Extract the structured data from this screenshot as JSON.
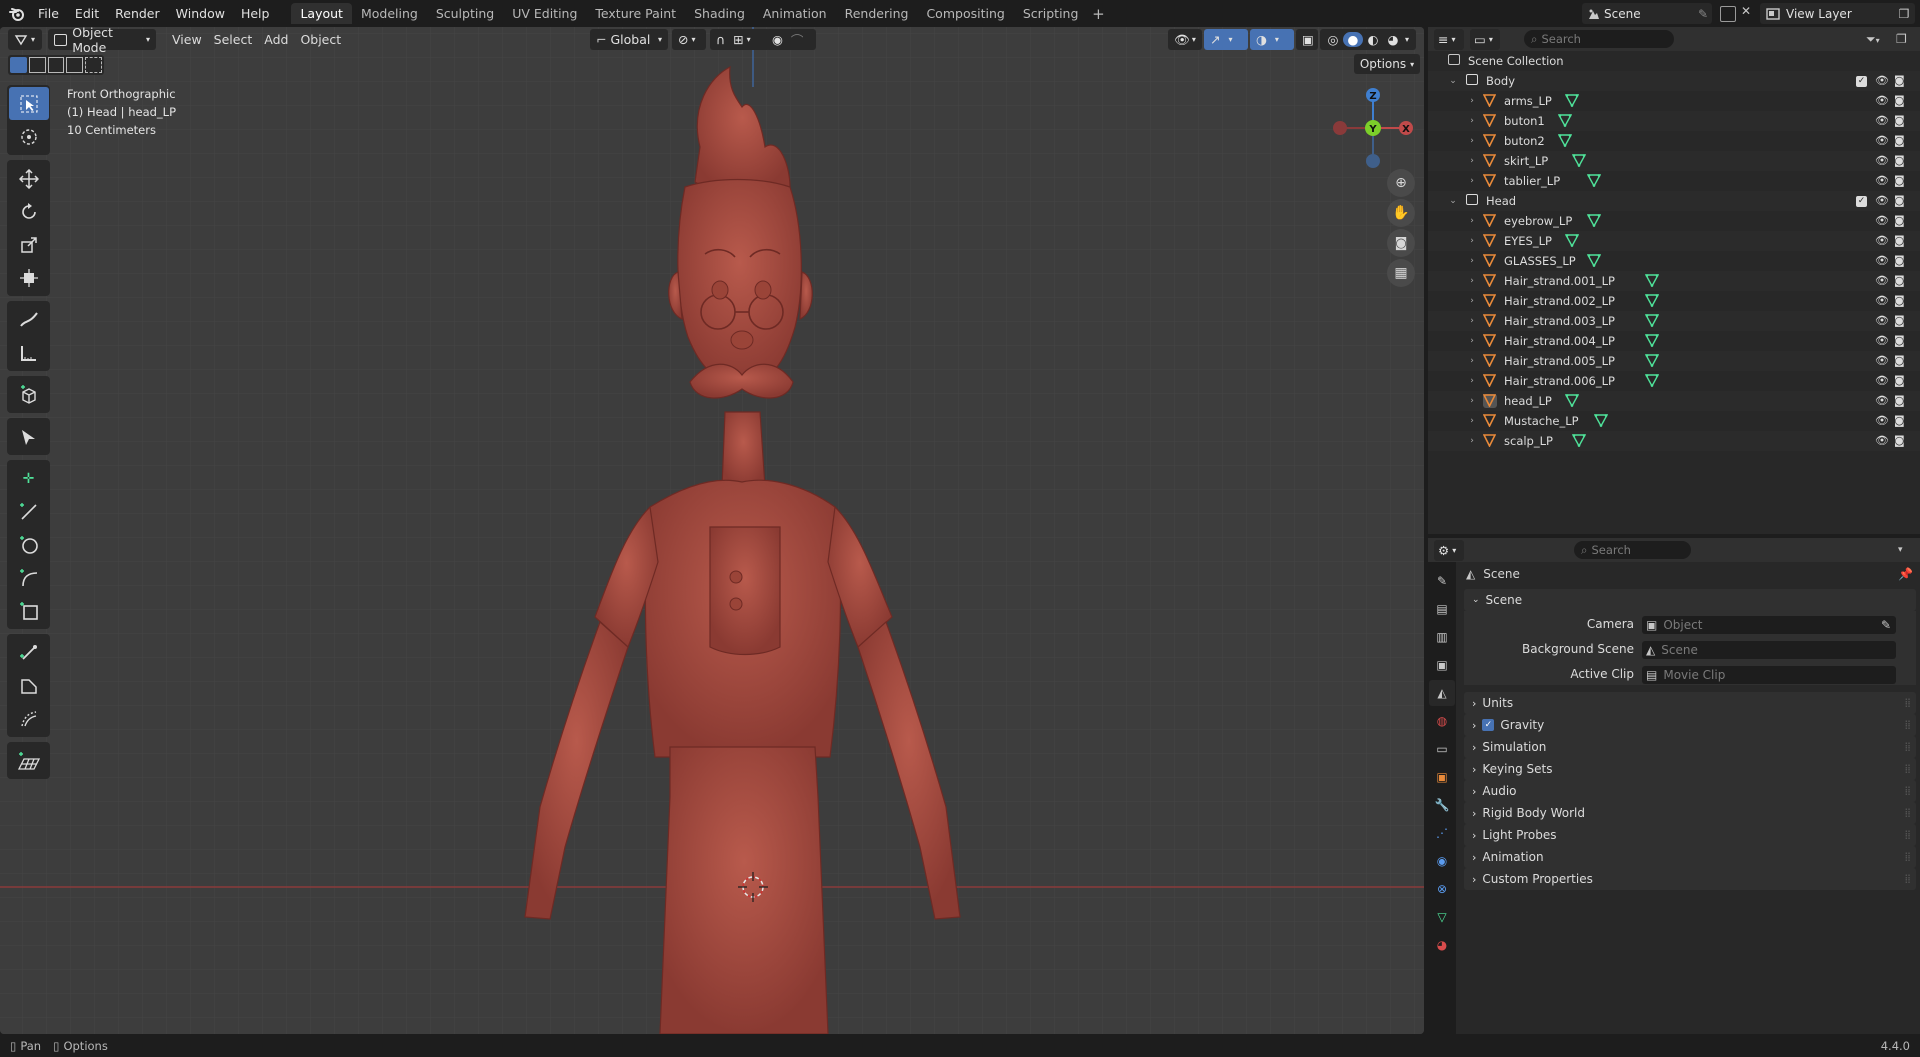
{
  "menu": {
    "items": [
      "File",
      "Edit",
      "Render",
      "Window",
      "Help"
    ]
  },
  "workspaces": {
    "tabs": [
      "Layout",
      "Modeling",
      "Sculpting",
      "UV Editing",
      "Texture Paint",
      "Shading",
      "Animation",
      "Rendering",
      "Compositing",
      "Scripting"
    ],
    "active": "Layout",
    "add": "+"
  },
  "scene_selector": "Scene",
  "view_layer": "View Layer",
  "viewport": {
    "mode": "Object Mode",
    "menus": [
      "View",
      "Select",
      "Add",
      "Object"
    ],
    "transform_orientation": "Global",
    "options_label": "Options",
    "info_line1": "Front Orthographic",
    "info_line2": "(1) Head | head_LP",
    "info_line3": "10 Centimeters",
    "gizmo_labels": {
      "z": "Z",
      "y": "Y",
      "x": "X"
    },
    "colors": {
      "background": "#3d3d3d",
      "model": "#a0473c",
      "x_axis": "#c04a4a",
      "y_axis": "#7ccf2a",
      "z_axis": "#3f7fd0",
      "accent": "#4772b3"
    }
  },
  "outliner": {
    "search_placeholder": "Search",
    "root": "Scene Collection",
    "collections": [
      {
        "name": "Body",
        "objects": [
          "arms_LP",
          "buton1",
          "buton2",
          "skirt_LP",
          "tablier_LP"
        ]
      },
      {
        "name": "Head",
        "objects": [
          "eyebrow_LP",
          "EYES_LP",
          "GLASSES_LP",
          "Hair_strand.001_LP",
          "Hair_strand.002_LP",
          "Hair_strand.003_LP",
          "Hair_strand.004_LP",
          "Hair_strand.005_LP",
          "Hair_strand.006_LP",
          "head_LP",
          "Mustache_LP",
          "scalp_LP"
        ]
      }
    ]
  },
  "properties": {
    "search_placeholder": "Search",
    "context": "Scene",
    "scene_panel": {
      "title": "Scene",
      "camera_label": "Camera",
      "camera_value": "Object",
      "background_label": "Background Scene",
      "background_value": "Scene",
      "clip_label": "Active Clip",
      "clip_value": "Movie Clip"
    },
    "panels": [
      "Units",
      "Gravity",
      "Simulation",
      "Keying Sets",
      "Audio",
      "Rigid Body World",
      "Light Probes",
      "Animation",
      "Custom Properties"
    ]
  },
  "status": {
    "pan": "Pan",
    "options": "Options",
    "version": "4.4.0"
  }
}
